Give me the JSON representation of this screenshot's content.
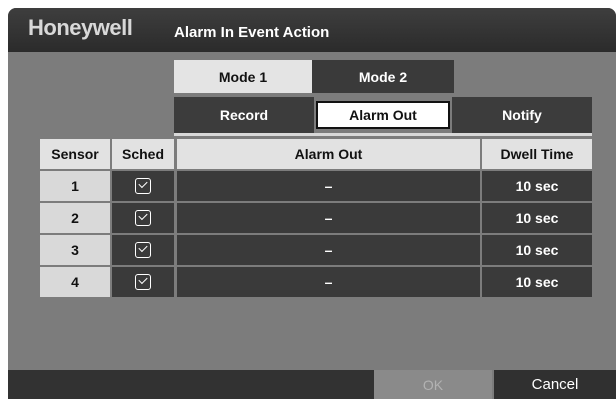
{
  "header": {
    "brand": "Honeywell",
    "title": "Alarm In Event Action"
  },
  "tabs": [
    {
      "label": "Mode 1"
    },
    {
      "label": "Mode 2"
    }
  ],
  "subtabs": [
    {
      "label": "Record"
    },
    {
      "label": "Alarm Out"
    },
    {
      "label": "Notify"
    }
  ],
  "table": {
    "headers": {
      "sensor": "Sensor",
      "sched": "Sched",
      "alarm_out": "Alarm Out",
      "dwell": "Dwell Time"
    },
    "rows": [
      {
        "sensor": "1",
        "sched": true,
        "alarm_out": "–",
        "dwell": "10 sec"
      },
      {
        "sensor": "2",
        "sched": true,
        "alarm_out": "–",
        "dwell": "10 sec"
      },
      {
        "sensor": "3",
        "sched": true,
        "alarm_out": "–",
        "dwell": "10 sec"
      },
      {
        "sensor": "4",
        "sched": true,
        "alarm_out": "–",
        "dwell": "10 sec"
      }
    ]
  },
  "buttons": {
    "ok": "OK",
    "cancel": "Cancel"
  }
}
